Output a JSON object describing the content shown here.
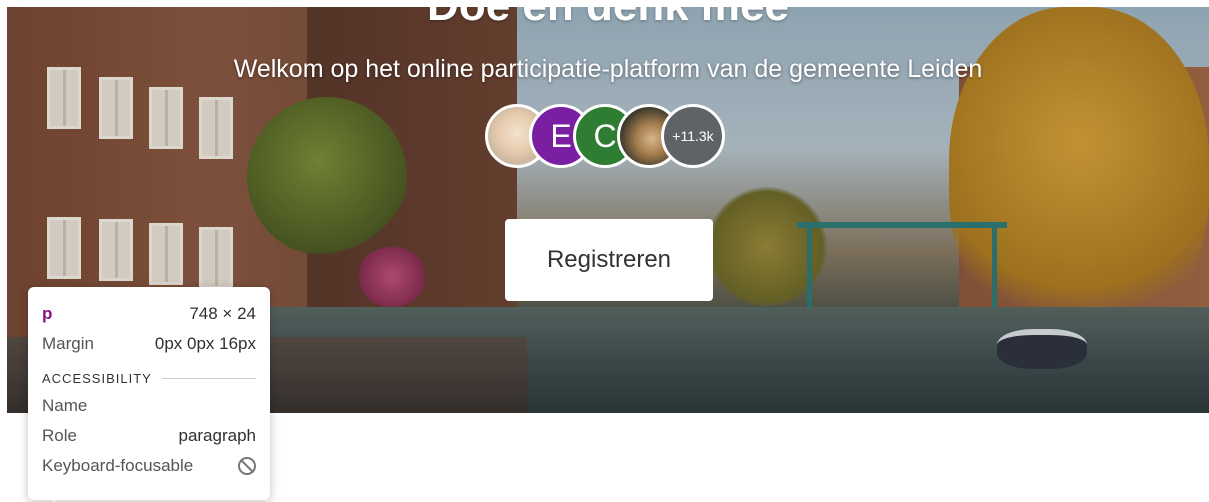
{
  "hero": {
    "title": "Doe en denk mee",
    "subtitle": "Welkom op het online participatie-platform van de gemeente Leiden",
    "avatars": [
      {
        "kind": "photo",
        "initial": ""
      },
      {
        "kind": "initial",
        "initial": "E",
        "color": "#7b1fa2"
      },
      {
        "kind": "initial",
        "initial": "C",
        "color": "#2e7d32"
      },
      {
        "kind": "photo",
        "initial": ""
      }
    ],
    "participant_count": "+11.3k",
    "count_color": "#5f6368",
    "register_label": "Registreren"
  },
  "inspector": {
    "element_tag": "p",
    "dimensions": "748 × 24",
    "margin_label": "Margin",
    "margin_value": "0px 0px 16px",
    "section_title": "ACCESSIBILITY",
    "name_label": "Name",
    "name_value": "",
    "role_label": "Role",
    "role_value": "paragraph",
    "focusable_label": "Keyboard-focusable",
    "focusable_icon": "not-allowed-icon"
  }
}
